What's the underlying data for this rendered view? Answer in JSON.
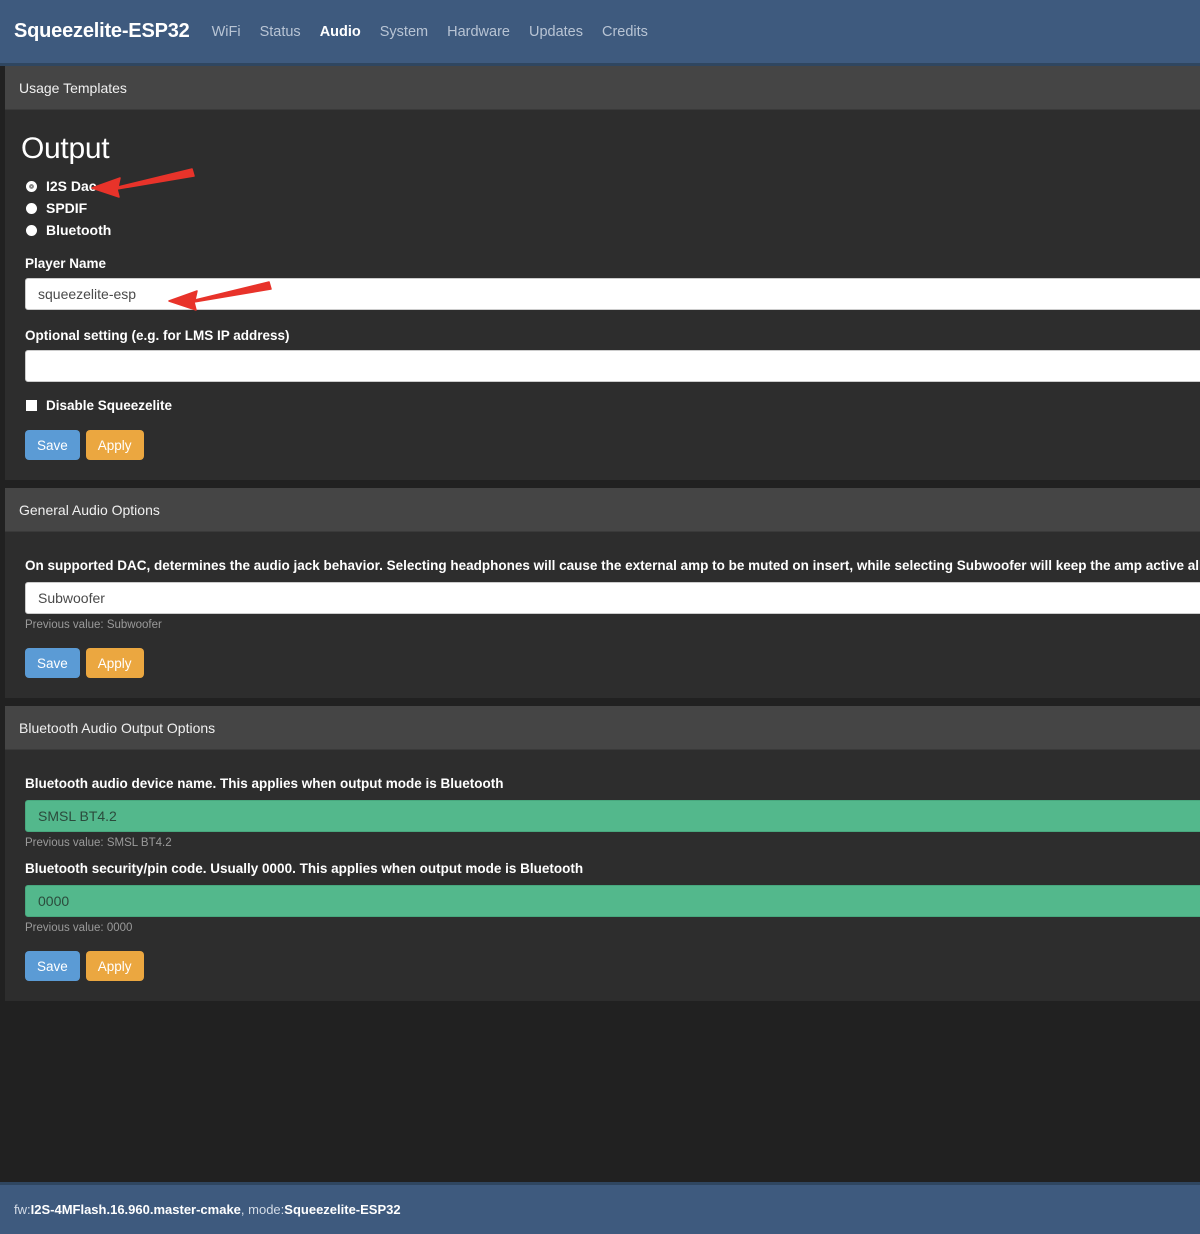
{
  "navbar": {
    "brand": "Squeezelite-ESP32",
    "links": [
      {
        "label": "WiFi",
        "active": false
      },
      {
        "label": "Status",
        "active": false
      },
      {
        "label": "Audio",
        "active": true
      },
      {
        "label": "System",
        "active": false
      },
      {
        "label": "Hardware",
        "active": false
      },
      {
        "label": "Updates",
        "active": false
      },
      {
        "label": "Credits",
        "active": false
      }
    ]
  },
  "panels": {
    "usage_templates": {
      "heading": "Usage Templates",
      "section_title": "Output",
      "radios": [
        {
          "label": "I2S Dac",
          "checked": true
        },
        {
          "label": "SPDIF",
          "checked": false
        },
        {
          "label": "Bluetooth",
          "checked": false
        }
      ],
      "player_name": {
        "label": "Player Name",
        "value": "squeezelite-esp",
        "placeholder": ""
      },
      "optional_setting": {
        "label": "Optional setting (e.g. for LMS IP address)",
        "value": "",
        "placeholder": ""
      },
      "disable_checkbox": {
        "label": "Disable Squeezelite",
        "checked": false
      },
      "save_label": "Save",
      "apply_label": "Apply"
    },
    "general_audio": {
      "heading": "General Audio Options",
      "help": "On supported DAC, determines the audio jack behavior. Selecting headphones will cause the external amp to be muted on insert, while selecting Subwoofer will keep the amp active all the time.",
      "jack_behavior": {
        "value": "Subwoofer",
        "placeholder": "",
        "previous": "Previous value: Subwoofer"
      },
      "save_label": "Save",
      "apply_label": "Apply"
    },
    "bluetooth_audio": {
      "heading": "Bluetooth Audio Output Options",
      "device_name": {
        "label": "Bluetooth audio device name. This applies when output mode is Bluetooth",
        "value": "SMSL BT4.2",
        "placeholder": "",
        "previous": "Previous value: SMSL BT4.2"
      },
      "pin_code": {
        "label": "Bluetooth security/pin code. Usually 0000. This applies when output mode is Bluetooth",
        "value": "0000",
        "placeholder": "",
        "previous": "Previous value: 0000"
      },
      "save_label": "Save",
      "apply_label": "Apply"
    }
  },
  "footer": {
    "fw_prefix": "fw: ",
    "fw_value": "I2S-4MFlash.16.960.master-cmake",
    "mode_prefix": ", mode: ",
    "mode_value": "Squeezelite-ESP32"
  },
  "annotations": {
    "arrow_color": "#e8332a",
    "arrows": [
      {
        "name": "arrow-pointing-to-i2s-dac-radio"
      },
      {
        "name": "arrow-pointing-to-player-name-input"
      }
    ]
  },
  "colors": {
    "navbar": "#3e5a7e",
    "body_bg": "#212121",
    "panel_heading": "#454545",
    "panel_body": "#2d2d2d",
    "save_button": "#5b9bd5",
    "apply_button": "#eba740",
    "green_input": "#53b88c"
  }
}
